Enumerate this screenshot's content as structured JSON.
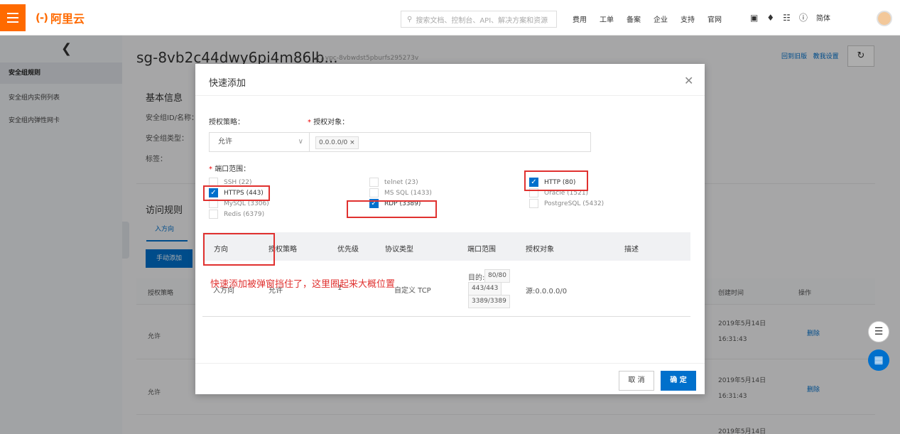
{
  "topbar": {
    "logo_mark": "(-)",
    "logo_text": "阿里云",
    "search_placeholder": "搜索文档、控制台、API、解决方案和资源",
    "nav": [
      "费用",
      "工单",
      "备案",
      "企业",
      "支持",
      "官网"
    ],
    "lang": "简体"
  },
  "sidebar": {
    "items": [
      {
        "label": "安全组规则"
      },
      {
        "label": "安全组内实例列表"
      },
      {
        "label": "安全组内弹性网卡"
      }
    ]
  },
  "page": {
    "title": "sg-8vb2c44dwy6pi4m86lb...",
    "subtitle": "/ vpc-8vbwdst5pburfs295273v",
    "link_old": "回到旧版",
    "link_settings": "教我设置",
    "basic_info": "基本信息",
    "sg_id_label": "安全组ID/名称：",
    "sg_type_label": "安全组类型：",
    "tags_label": "标签：",
    "access_rules": "访问规则",
    "tab_inbound": "入方向",
    "manual_add": "手动添加",
    "bg_columns": {
      "policy": "授权策略",
      "created": "创建时间",
      "ops": "操作"
    },
    "bg_rows": [
      {
        "policy": "允许",
        "date": "2019年5月14日",
        "time": "16:31:43",
        "op": "删除"
      },
      {
        "policy": "允许",
        "date": "2019年5月14日",
        "time": "16:31:43",
        "op": "删除"
      },
      {
        "date": "2019年5月14日"
      }
    ]
  },
  "modal": {
    "title": "快速添加",
    "policy_label": "授权策略：",
    "target_label": "授权对象：",
    "policy_value": "允许",
    "target_tag": "0.0.0.0/0 ×",
    "port_range_label": "端口范围：",
    "ports": [
      {
        "label": "SSH (22)",
        "checked": false
      },
      {
        "label": "HTTPS (443)",
        "checked": true
      },
      {
        "label": "MySQL (3306)",
        "checked": false
      },
      {
        "label": "Redis (6379)",
        "checked": false
      },
      {
        "label": "telnet (23)",
        "checked": false
      },
      {
        "label": "MS SQL (1433)",
        "checked": false
      },
      {
        "label": "RDP (3389)",
        "checked": true
      },
      {
        "label": "HTTP (80)",
        "checked": true
      },
      {
        "label": "Oracle (1521)",
        "checked": false
      },
      {
        "label": "PostgreSQL (5432)",
        "checked": false
      }
    ],
    "columns": [
      "方向",
      "授权策略",
      "优先级",
      "协议类型",
      "端口范围",
      "授权对象",
      "描述"
    ],
    "row": {
      "direction": "入方向",
      "policy": "允许",
      "priority": "1",
      "protocol": "自定义 TCP",
      "port_prefix": "目的:",
      "ports": [
        "80/80",
        "443/443",
        "3389/3389"
      ],
      "target": "源:0.0.0.0/0"
    },
    "cancel": "取 消",
    "ok": "确 定"
  },
  "annotation": "快速添加被弹窗挡住了，这里圈起来大概位置",
  "colors": {
    "brand": "#ff6a00",
    "primary": "#0070cc",
    "annotation": "#e0312f"
  }
}
